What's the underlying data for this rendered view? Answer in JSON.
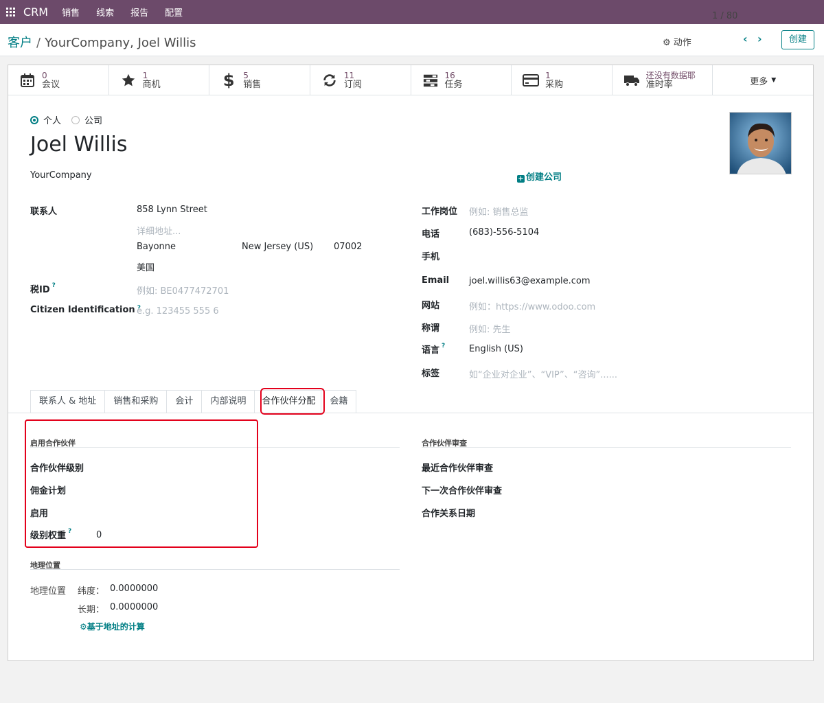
{
  "navbar": {
    "brand": "CRM",
    "items": [
      "销售",
      "线索",
      "报告",
      "配置"
    ]
  },
  "control": {
    "breadcrumb_parent": "客户",
    "breadcrumb_current": "YourCompany, Joel Willis",
    "action": "动作",
    "pager": "1 / 80",
    "create": "创建"
  },
  "smart_buttons": [
    {
      "icon": "calendar-icon",
      "value": "0",
      "label": "会议"
    },
    {
      "icon": "star-icon",
      "value": "1",
      "label": "商机"
    },
    {
      "icon": "dollar-icon",
      "value": "5",
      "label": "销售"
    },
    {
      "icon": "refresh-icon",
      "value": "11",
      "label": "订阅"
    },
    {
      "icon": "tasks-icon",
      "value": "16",
      "label": "任务"
    },
    {
      "icon": "credit-card-icon",
      "value": "1",
      "label": "采购"
    },
    {
      "icon": "truck-icon",
      "value": "还没有数据耶",
      "label": "准时率"
    }
  ],
  "more": "更多",
  "form": {
    "radio_person": "个人",
    "radio_company": "公司",
    "name": "Joel Willis",
    "company": "YourCompany",
    "create_company": "创建公司",
    "contact_label": "联系人",
    "street": "858 Lynn Street",
    "street2_placeholder": "详细地址...",
    "city": "Bayonne",
    "state": "New Jersey (US)",
    "zip": "07002",
    "country": "美国",
    "tax_label": "税ID",
    "tax_placeholder": "例如: BE0477472701",
    "citizen_label": "Citizen Identification",
    "citizen_placeholder": "e.g. 123455 555 6",
    "job_label": "工作岗位",
    "job_placeholder": "例如: 销售总监",
    "phone_label": "电话",
    "phone": "(683)-556-5104",
    "mobile_label": "手机",
    "email_label": "Email",
    "email": "joel.willis63@example.com",
    "website_label": "网站",
    "website_placeholder": "例如：https://www.odoo.com",
    "title_label": "称谓",
    "title_placeholder": "例如: 先生",
    "lang_label": "语言",
    "lang": "English (US)",
    "tags_label": "标签",
    "tags_placeholder": "如“企业对企业”、“VIP”、“咨询”......"
  },
  "tabs": [
    "联系人 & 地址",
    "销售和采购",
    "会计",
    "内部说明",
    "合作伙伴分配",
    "会籍"
  ],
  "partner": {
    "section_left": "启用合作伙伴",
    "level_label": "合作伙伴级别",
    "commission_label": "佣金计划",
    "activation_label": "启用",
    "weight_label": "级别权重",
    "weight_value": "0",
    "section_right": "合作伙伴审查",
    "latest_review_label": "最近合作伙伴审查",
    "next_review_label": "下一次合作伙伴审查",
    "partnership_date_label": "合作关系日期"
  },
  "geo": {
    "section": "地理位置",
    "label": "地理位置",
    "lat_label": "纬度：",
    "lat_value": "0.0000000",
    "long_label": "长期：",
    "long_value": "0.0000000",
    "compute": "基于地址的计算"
  }
}
